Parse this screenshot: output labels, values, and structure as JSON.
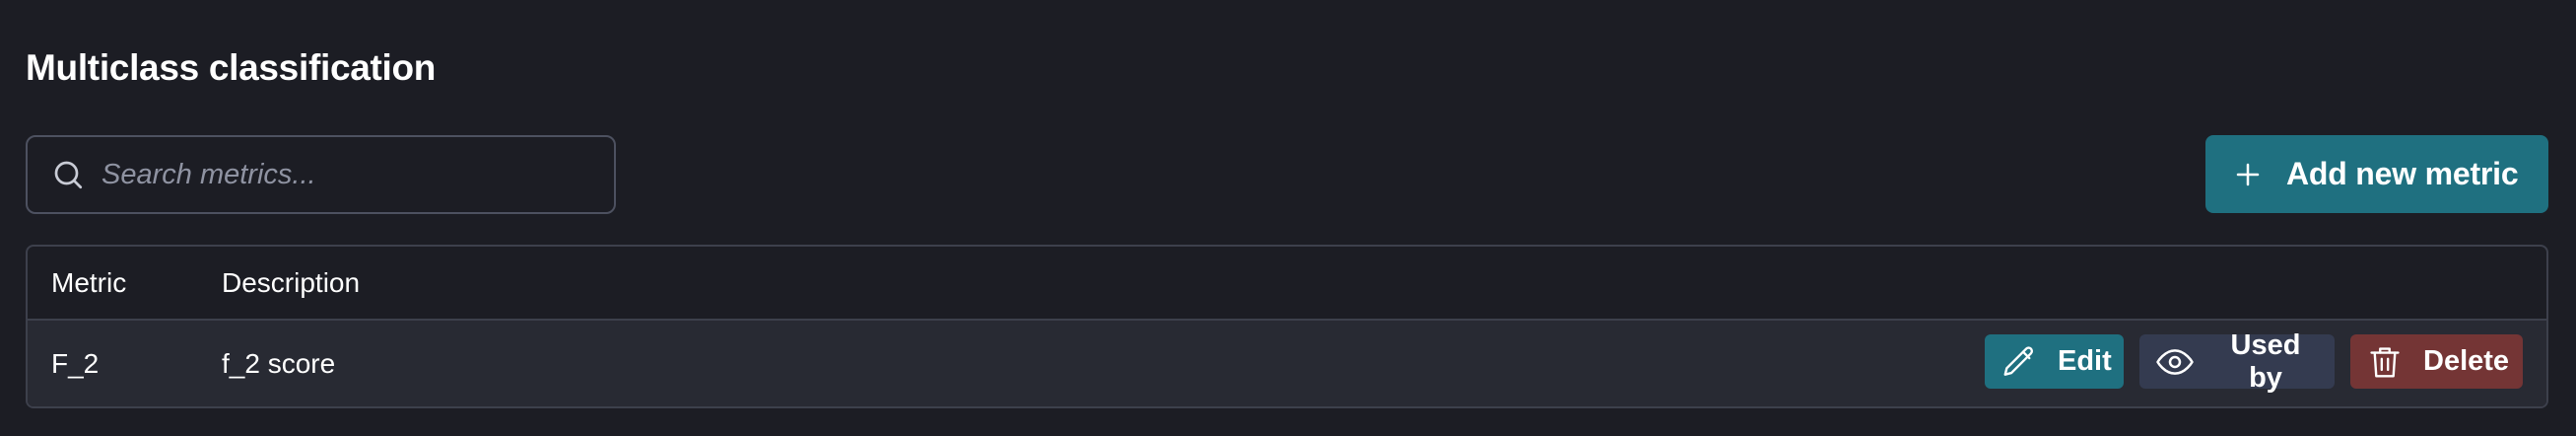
{
  "page": {
    "title": "Multiclass classification"
  },
  "search": {
    "placeholder": "Search metrics...",
    "value": "",
    "icon": "search-icon"
  },
  "toolbar": {
    "add_label": "Add new metric",
    "add_icon": "plus-icon"
  },
  "table": {
    "columns": [
      "Metric",
      "Description"
    ],
    "rows": [
      {
        "metric": "F_2",
        "description": "f_2 score",
        "actions": {
          "edit_label": "Edit",
          "used_by_label": "Used by",
          "delete_label": "Delete"
        }
      }
    ]
  },
  "colors": {
    "background": "#1c1d24",
    "row_background": "#282a33",
    "primary": "#1f7080",
    "secondary": "#343b50",
    "danger": "#743535",
    "border": "#3d404c"
  }
}
